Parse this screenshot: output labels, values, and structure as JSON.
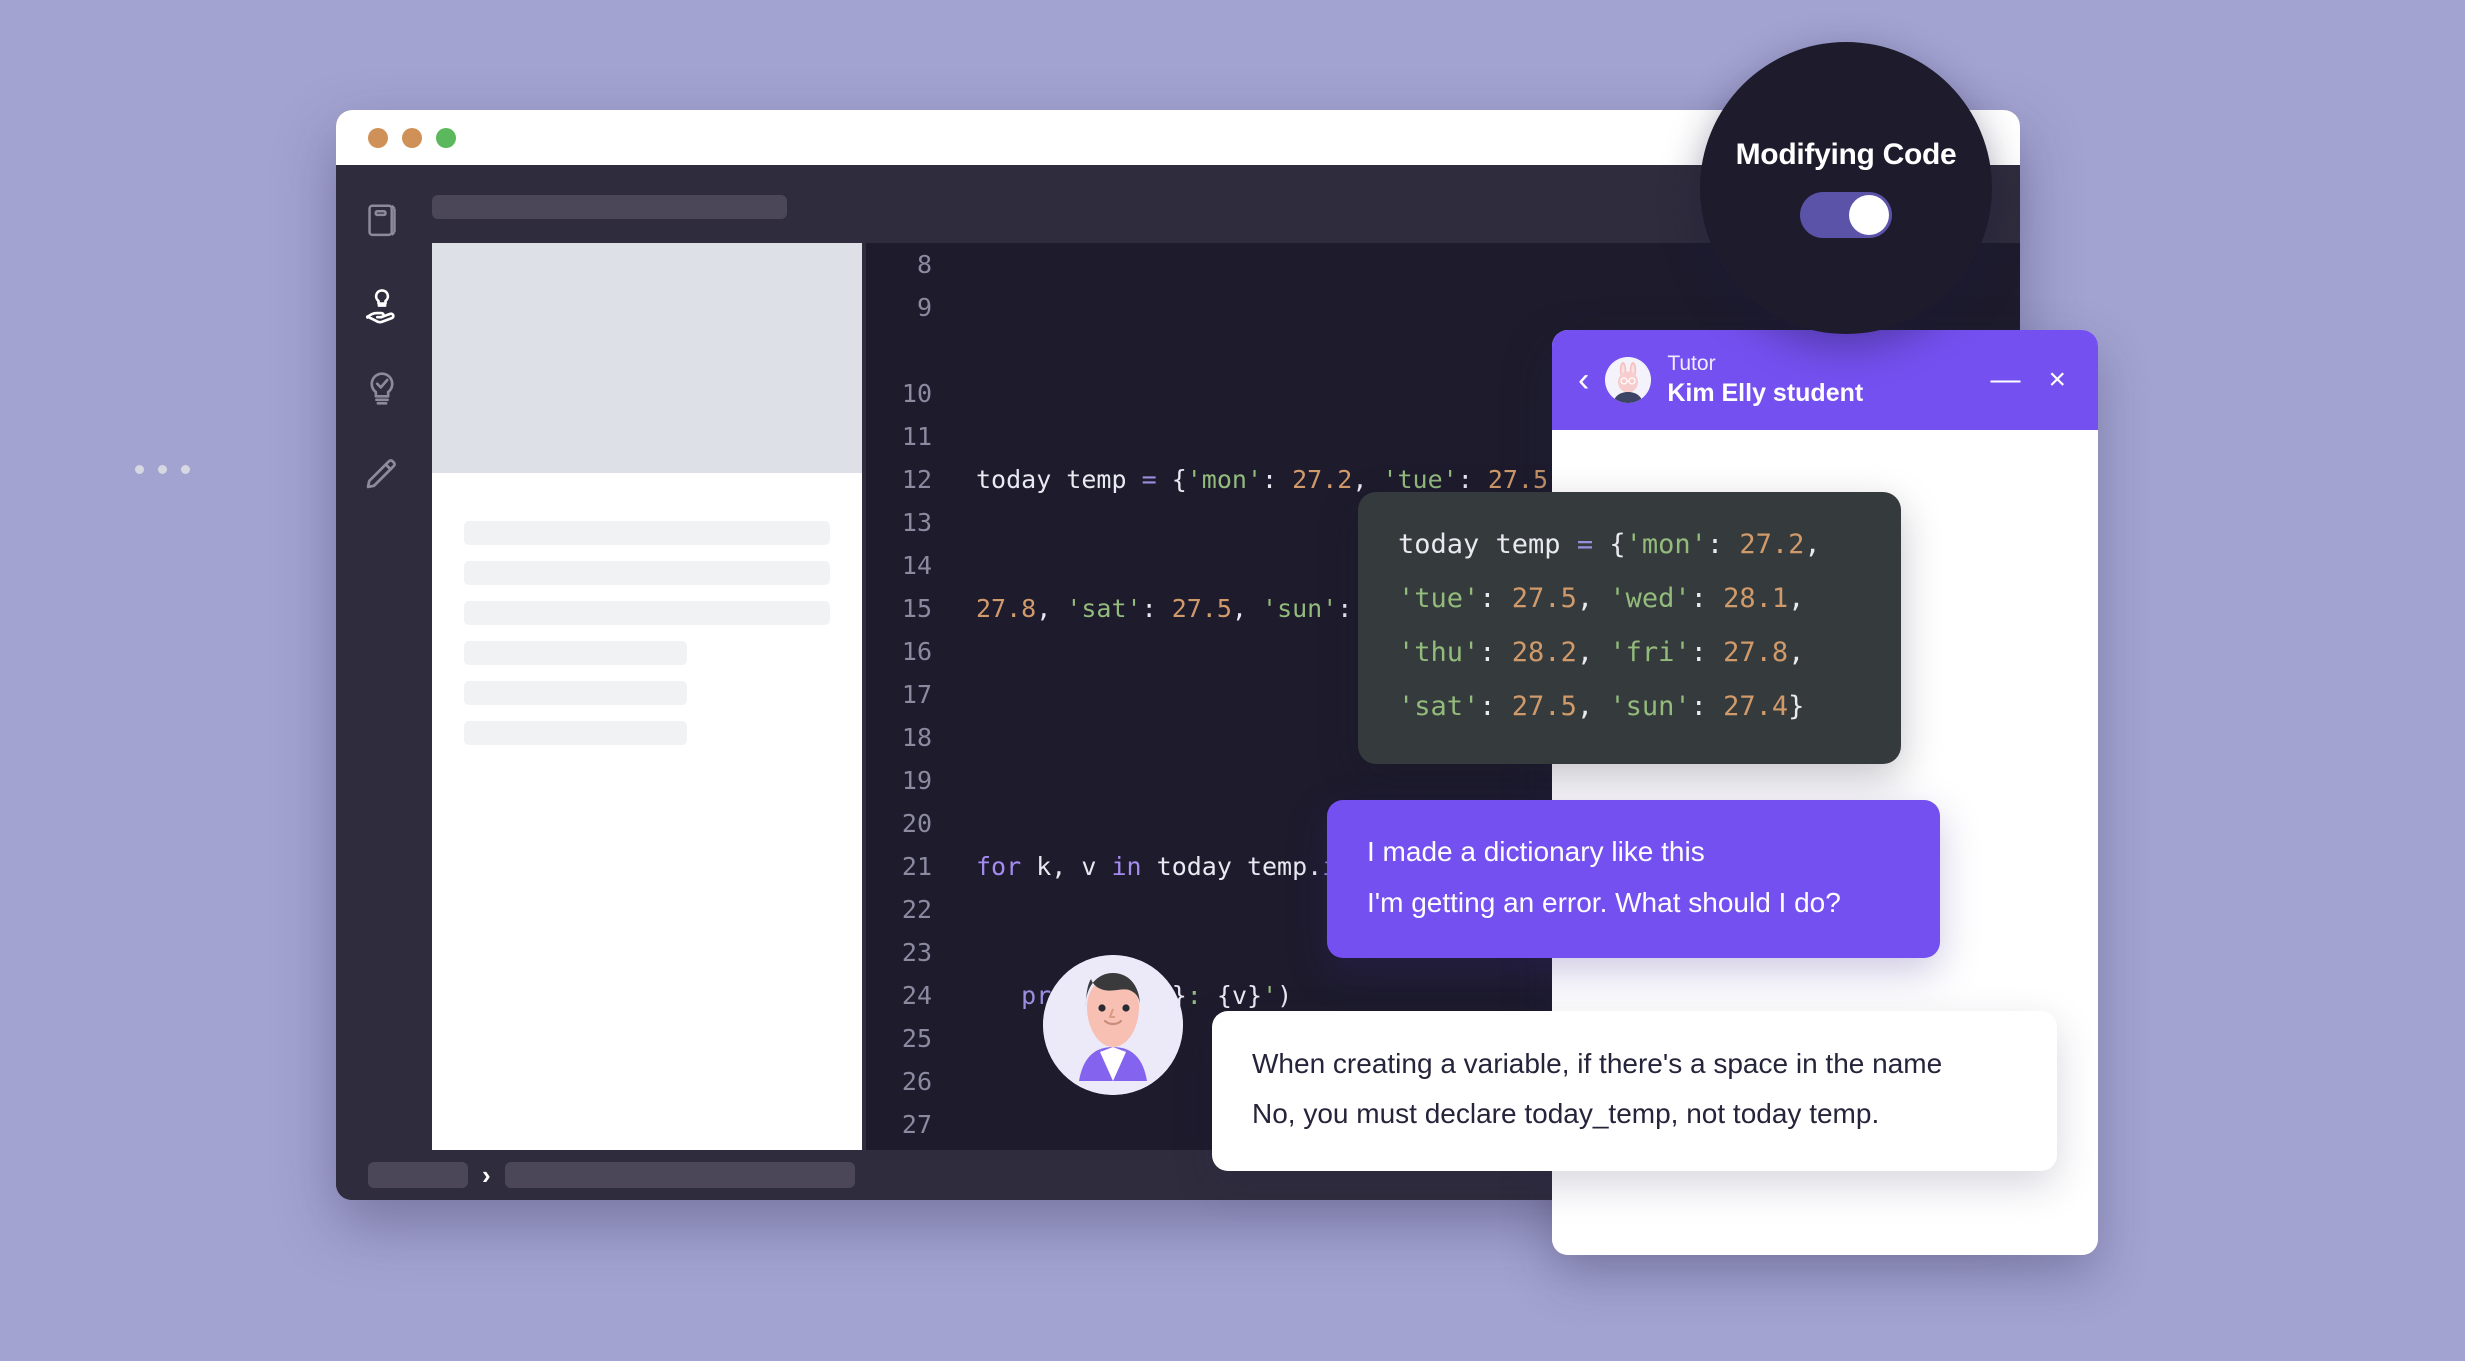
{
  "background_color": "#a3a3d2",
  "ide": {
    "window_controls": [
      "close-dot",
      "minimize-dot",
      "maximize-dot"
    ],
    "window_control_colors": [
      "#cf9157",
      "#cf9157",
      "#5cb85c"
    ],
    "sidebar": {
      "items": [
        {
          "icon": "book-icon",
          "active": false
        },
        {
          "icon": "hand-lightbulb-icon",
          "active": true
        },
        {
          "icon": "lightbulb-check-icon",
          "active": false
        },
        {
          "icon": "pencil-icon",
          "active": false
        }
      ]
    },
    "editor": {
      "language": "python",
      "first_line_number": 8,
      "last_line_number": 27,
      "line_numbers": [
        8,
        9,
        10,
        11,
        12,
        13,
        14,
        15,
        16,
        17,
        18,
        19,
        20,
        21,
        22,
        23,
        24,
        25,
        26,
        27
      ],
      "code_lines": [
        {
          "number": 8,
          "text": ""
        },
        {
          "number": 9,
          "text": "today temp = {'mon': 27.2, 'tue': 27.5, 'wed': 28.1, 'thu': 28.2, 'fri': 27.8, 'sat': 27.5, 'sun': 27.4}"
        },
        {
          "number": 10,
          "text": ""
        },
        {
          "number": 11,
          "text": "for k, v in today temp.items():"
        },
        {
          "number": 12,
          "text": "    print(f'{k}: {v}')"
        }
      ],
      "syntax_colors": {
        "string": "#93bb7c",
        "number": "#d09a6a",
        "keyword": "#a48bf0",
        "variable": "#e9e9f2",
        "operator": "#9a8ede",
        "background": "#1d1b2c"
      }
    }
  },
  "modifying_badge": {
    "title": "Modifying Code",
    "toggle_on": true,
    "toggle_color": "#5a53a8",
    "background": "#1d1b2c"
  },
  "chat": {
    "header": {
      "back_icon": "chevron-left-icon",
      "avatar_icon": "rabbit-avatar",
      "role": "Tutor",
      "name": "Kim Elly student",
      "minimize_label": "—",
      "close_label": "×",
      "accent_color": "#7550f0"
    },
    "messages": [
      {
        "type": "code",
        "code_tokens": [
          {
            "t": "today temp ",
            "c": "var"
          },
          {
            "t": "= ",
            "c": "op"
          },
          {
            "t": "{",
            "c": "pun"
          },
          {
            "t": "'mon'",
            "c": "str"
          },
          {
            "t": ": ",
            "c": "pun"
          },
          {
            "t": "27.2",
            "c": "num"
          },
          {
            "t": ", ",
            "c": "pun"
          },
          {
            "t": "'tue'",
            "c": "str"
          },
          {
            "t": ": ",
            "c": "pun"
          },
          {
            "t": "27.5",
            "c": "num"
          },
          {
            "t": ", ",
            "c": "pun"
          },
          {
            "t": "'wed'",
            "c": "str"
          },
          {
            "t": ": ",
            "c": "pun"
          },
          {
            "t": "28.1",
            "c": "num"
          },
          {
            "t": ", ",
            "c": "pun"
          },
          {
            "t": "'thu'",
            "c": "str"
          },
          {
            "t": ": ",
            "c": "pun"
          },
          {
            "t": "28.2",
            "c": "num"
          },
          {
            "t": ", ",
            "c": "pun"
          },
          {
            "t": "'fri'",
            "c": "str"
          },
          {
            "t": ": ",
            "c": "pun"
          },
          {
            "t": "27.8",
            "c": "num"
          },
          {
            "t": ", ",
            "c": "pun"
          },
          {
            "t": "'sat'",
            "c": "str"
          },
          {
            "t": ": ",
            "c": "pun"
          },
          {
            "t": "27.5",
            "c": "num"
          },
          {
            "t": ", ",
            "c": "pun"
          },
          {
            "t": "'sun'",
            "c": "str"
          },
          {
            "t": ": ",
            "c": "pun"
          },
          {
            "t": "27.4",
            "c": "num"
          },
          {
            "t": "}",
            "c": "pun"
          }
        ]
      },
      {
        "type": "user",
        "line1": "I made a dictionary like this",
        "line2": "I'm getting an error. What should I do?"
      },
      {
        "type": "tutor",
        "line1": "When creating a variable, if there's a space in the name",
        "line2": "No, you must declare today_temp, not today temp."
      }
    ],
    "typing_indicator": true
  }
}
